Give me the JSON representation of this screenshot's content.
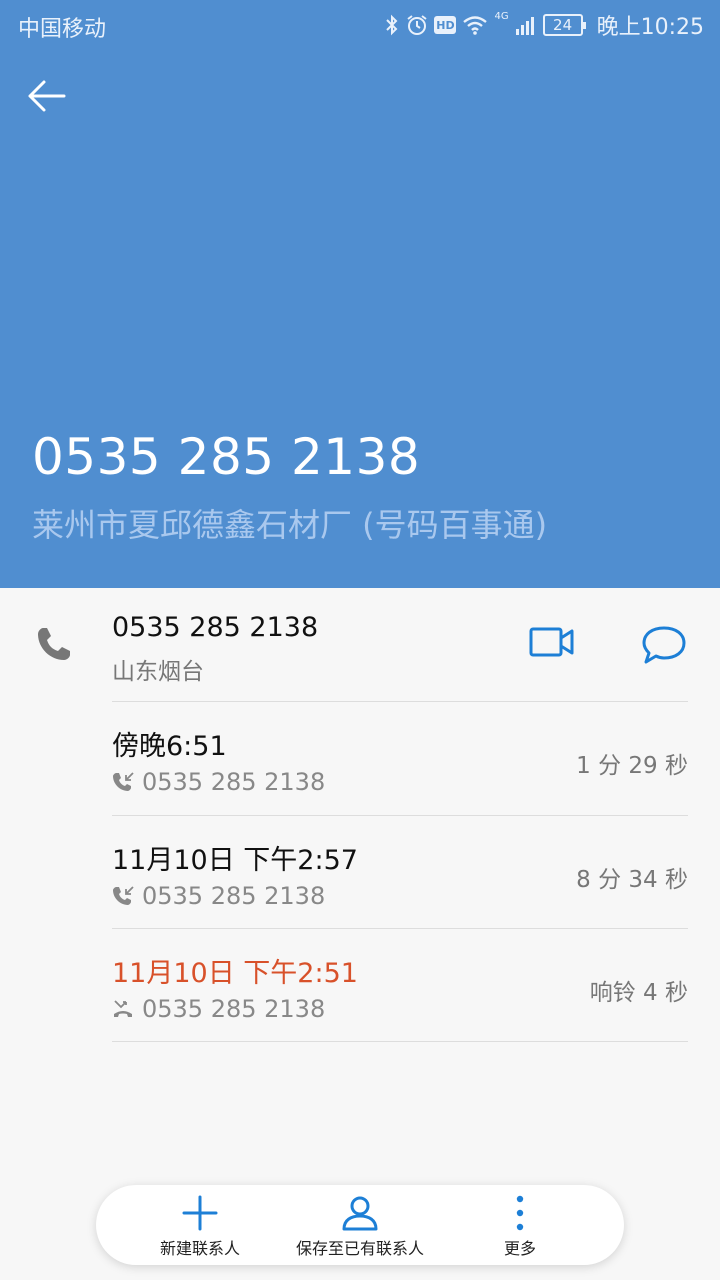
{
  "status": {
    "carrier": "中国移动",
    "network": "4G",
    "battery": "24",
    "time": "晚上10:25"
  },
  "header": {
    "number": "0535 285 2138",
    "description": "莱州市夏邱德鑫石材厂 (号码百事通)",
    "color": "#508ed0"
  },
  "contact": {
    "number": "0535 285 2138",
    "location": "山东烟台"
  },
  "calls": [
    {
      "time": "傍晚6:51",
      "number": "0535 285 2138",
      "duration": "1 分 29 秒",
      "type": "incoming"
    },
    {
      "time": "11月10日 下午2:57",
      "number": "0535 285 2138",
      "duration": "8 分 34 秒",
      "type": "incoming"
    },
    {
      "time": "11月10日 下午2:51",
      "number": "0535 285 2138",
      "duration": "响铃 4 秒",
      "type": "missed"
    }
  ],
  "bottom": {
    "new_contact": "新建联系人",
    "save_existing": "保存至已有联系人",
    "more": "更多"
  },
  "colors": {
    "accent": "#1d7fd6",
    "missed": "#d8512a"
  }
}
